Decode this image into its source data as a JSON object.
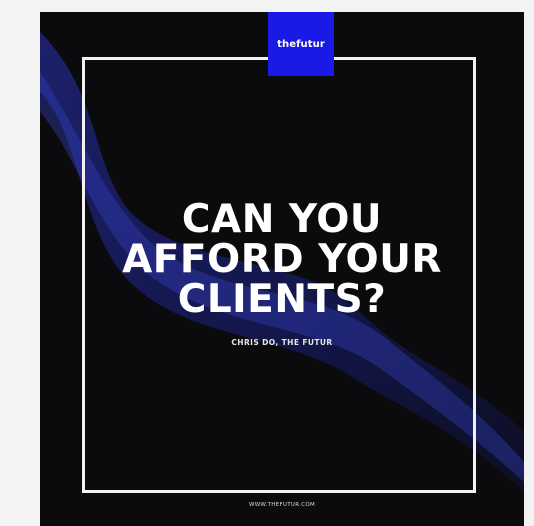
{
  "poster": {
    "brand": "thefutur",
    "headline": [
      "CAN YOU",
      "AFFORD YOUR",
      "CLIENTS?"
    ],
    "byline": "CHRIS DO, THE FUTUR",
    "website": "WWW.THEFUTUR.COM"
  },
  "colors": {
    "background": "#0b0b0e",
    "accent": "#1a1ae6",
    "frame": "#f2f2f2",
    "text": "#ffffff"
  }
}
